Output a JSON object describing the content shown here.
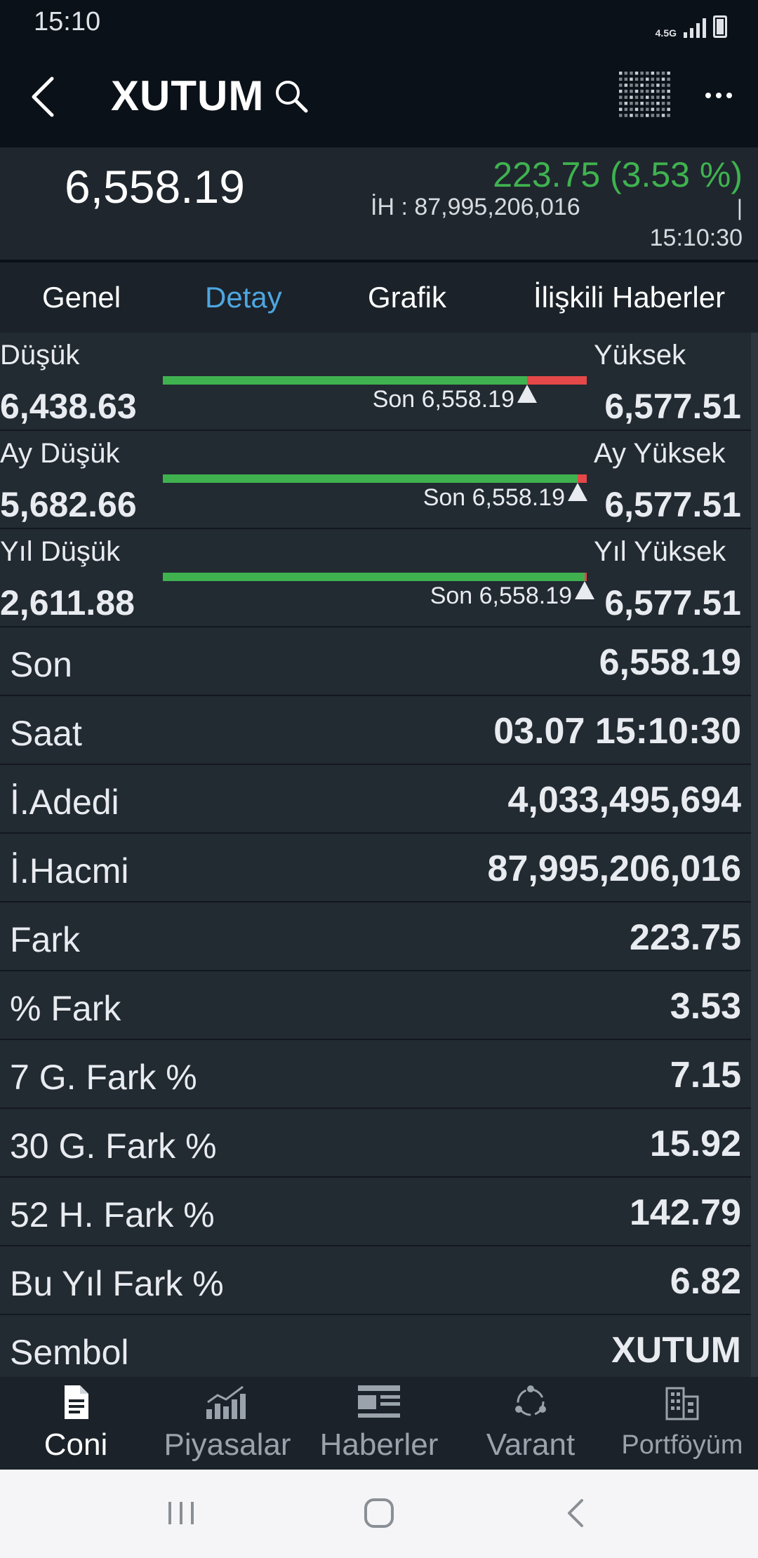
{
  "status_bar": {
    "time": "15:10",
    "network": "4.5G"
  },
  "app_bar": {
    "title": "XUTUM"
  },
  "price": {
    "last": "6,558.19",
    "change": "223.75 (3.53 %)",
    "volume_label": "İH : 87,995,206,016",
    "separator": "|",
    "time": "15:10:30"
  },
  "tabs": [
    {
      "label": "Genel"
    },
    {
      "label": "Detay"
    },
    {
      "label": "Grafik"
    },
    {
      "label": "İlişkili Haberler"
    }
  ],
  "ranges": [
    {
      "low_label": "Düşük",
      "low_value": "6,438.63",
      "high_label": "Yüksek",
      "high_value": "6,577.51",
      "son_label": "Son 6,558.19",
      "position": 0.86
    },
    {
      "low_label": "Ay Düşük",
      "low_value": "5,682.66",
      "high_label": "Ay Yüksek",
      "high_value": "6,577.51",
      "son_label": "Son 6,558.19",
      "position": 0.978
    },
    {
      "low_label": "Yıl Düşük",
      "low_value": "2,611.88",
      "high_label": "Yıl Yüksek",
      "high_value": "6,577.51",
      "son_label": "Son 6,558.19",
      "position": 0.995
    }
  ],
  "details": [
    {
      "label": "Son",
      "value": "6,558.19"
    },
    {
      "label": "Saat",
      "value": "03.07 15:10:30"
    },
    {
      "label": "İ.Adedi",
      "value": "4,033,495,694"
    },
    {
      "label": "İ.Hacmi",
      "value": "87,995,206,016"
    },
    {
      "label": "Fark",
      "value": "223.75"
    },
    {
      "label": "% Fark",
      "value": "3.53"
    },
    {
      "label": "7 G. Fark %",
      "value": "7.15"
    },
    {
      "label": "30 G. Fark %",
      "value": "15.92"
    },
    {
      "label": "52 H. Fark %",
      "value": "142.79"
    },
    {
      "label": "Bu Yıl Fark %",
      "value": "6.82"
    },
    {
      "label": "Sembol",
      "value": "XUTUM"
    }
  ],
  "bottom_nav": [
    {
      "label": "Coni",
      "icon": "document-icon"
    },
    {
      "label": "Piyasalar",
      "icon": "chart-icon"
    },
    {
      "label": "Haberler",
      "icon": "news-icon"
    },
    {
      "label": "Varant",
      "icon": "share-icon"
    },
    {
      "label": "Portföyüm",
      "icon": "building-icon"
    }
  ],
  "colors": {
    "positive": "#3fb24f",
    "negative": "#e44848",
    "accent": "#4ea6e0"
  }
}
